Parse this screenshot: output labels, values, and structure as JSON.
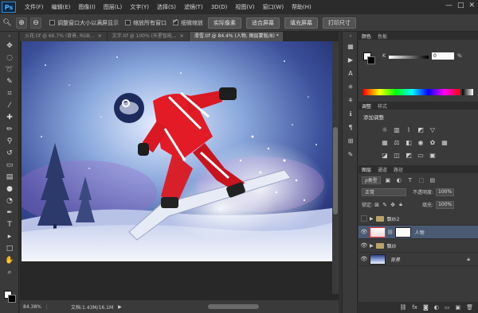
{
  "app": {
    "logo": "Ps"
  },
  "menu": [
    "文件(F)",
    "编辑(E)",
    "图像(I)",
    "图层(L)",
    "文字(Y)",
    "选择(S)",
    "滤镜(T)",
    "3D(D)",
    "视图(V)",
    "窗口(W)",
    "帮助(H)"
  ],
  "window_controls": {
    "minimize": "—",
    "restore": "□",
    "close": "✕"
  },
  "options": {
    "resize_windows": "调整窗口大小以满屏显示",
    "zoom_all": "缩放所有窗口",
    "scrubby_zoom": "细微缩放",
    "actual_pixels": "实际像素",
    "fit_screen": "适合屏幕",
    "fill_screen": "填充屏幕",
    "print_size": "打印尺寸"
  },
  "tabs": [
    {
      "label": "火花.tif @ 66.7% (背景, RGB...",
      "close": "×"
    },
    {
      "label": "文字.tif @ 100% (天星智能...",
      "close": "×"
    },
    {
      "label": "滑雪.tif @ 84.4% (人物, 图层蒙版/8) *",
      "close": "×"
    }
  ],
  "status": {
    "zoom": "84.38%",
    "doc": "文档:1.43M/16.1M",
    "arrow": "▶"
  },
  "panels": {
    "color": {
      "tab1": "颜色",
      "tab2": "色板",
      "channel": "K",
      "value": "0",
      "unit": "%"
    },
    "adjust": {
      "tab1": "调整",
      "tab2": "样式",
      "title": "添加调整"
    },
    "layers": {
      "tab1": "图层",
      "tab2": "通道",
      "tab3": "路径",
      "filter": "ρ类型",
      "blend": "正常",
      "opacity_label": "不透明度:",
      "opacity": "100%",
      "lock_label": "锁定:",
      "fill_label": "填充:",
      "fill": "100%",
      "items": [
        {
          "name": "飘纱2"
        },
        {
          "name": "人物"
        },
        {
          "name": "飘纱"
        },
        {
          "name": "背景"
        }
      ]
    }
  }
}
